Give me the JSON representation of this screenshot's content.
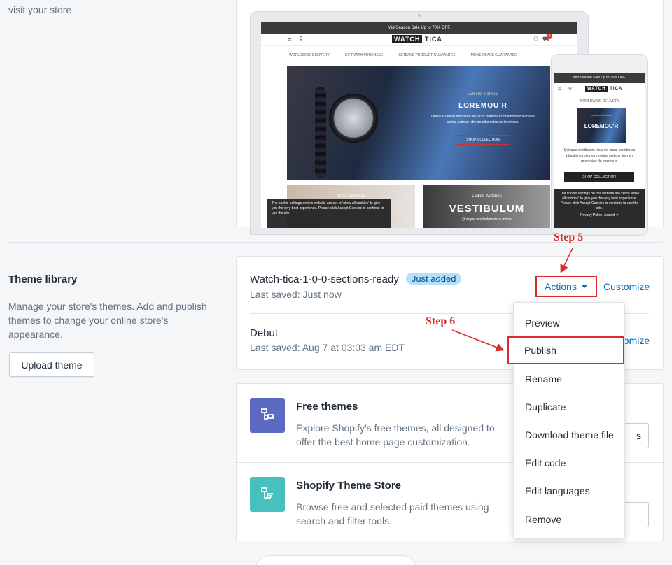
{
  "intro": {
    "text": "visit your store."
  },
  "preview": {
    "laptop": {
      "promo": "Mid-Season Sale Up to 70% OFF.",
      "logo_a": "WATCH",
      "logo_b": "TICA",
      "cart_count": "0",
      "features": [
        "WORLDWIDE DELIVERY",
        "GIFT WITH PURCHASE",
        "GENUINE PRODUCT GUARANTEE",
        "MONEY BACK GUARANTEE"
      ],
      "hero": {
        "sub": "Luminor Panerai",
        "title": "LOREMOU'R",
        "desc": "Quisque vestibulum risus vel lacus porttitor ac blandit morbi ornare metus sedeus nibh en mlanceios de loremous.",
        "button": "SHOP COLLECTION"
      },
      "tile1": "Men's Watches",
      "tile2_sub": "Ladies Watches",
      "tile2_title": "VESTIBULUM",
      "tile2_desc": "Quisque vestibulum risus molus",
      "cookie": "The cookie settings on this website are set to 'allow all cookies' to give you the very best experience. Please click Accept Cookies to continue to use the site."
    },
    "phone": {
      "promo": "Mid-Season Sale Up to 70% OFF.",
      "logo_a": "WATCH",
      "logo_b": "TICA",
      "feature": "WORLDWIDE DELIVERY",
      "hero_sub": "Luminor Panerai",
      "hero_title": "LOREMOU'R",
      "desc": "Quisque vestibulum risus vel lacus porttitor ac blandit morbi ornare metus sedeus nibh en mlanceios de loremous.",
      "button": "SHOP COLLECTION",
      "cookie": "The cookie settings on this website are set to 'allow all cookies' to give you the very best experience. Please click Accept Cookies to continue to use the site.",
      "privacy": "Privacy Policy",
      "accept": "Accept ✔"
    }
  },
  "theme_library": {
    "title": "Theme library",
    "description": "Manage your store's themes. Add and publish themes to change your online store's appearance.",
    "upload_button": "Upload theme",
    "themes": [
      {
        "name": "Watch-tica-1-0-0-sections-ready",
        "badge": "Just added",
        "saved": "Last saved: Just now",
        "actions": "Actions",
        "customize": "Customize"
      },
      {
        "name": "Debut",
        "saved": "Last saved: Aug 7 at 03:03 am EDT",
        "customize": "Customize"
      }
    ]
  },
  "steps": {
    "step5": "Step 5",
    "step6": "Step 6"
  },
  "actions_menu": [
    "Preview",
    "Publish",
    "Rename",
    "Duplicate",
    "Download theme file",
    "Edit code",
    "Edit languages",
    "Remove"
  ],
  "stores": [
    {
      "title": "Free themes",
      "desc": "Explore Shopify's free themes, all designed to offer the best home page customization.",
      "button": "s",
      "icon_color": "#5c6ac4"
    },
    {
      "title": "Shopify Theme Store",
      "desc": "Browse free and selected paid themes using search and filter tools.",
      "button": "",
      "icon_color": "#47c1bf"
    }
  ],
  "colors": {
    "accent": "#006fbb",
    "highlight": "#d82c2c",
    "badge_bg": "#b4e1fa"
  }
}
